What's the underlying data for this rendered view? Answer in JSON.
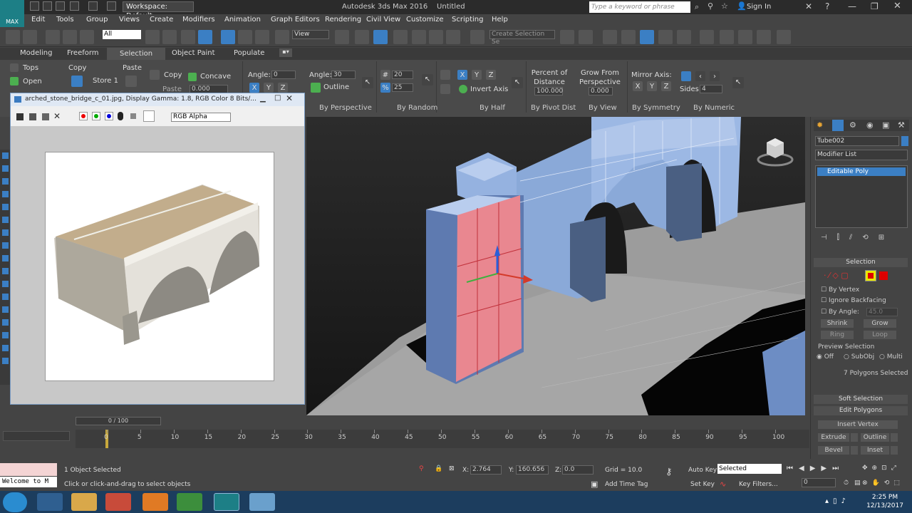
{
  "titlebar": {
    "logo": "MAX",
    "workspace": "Workspace: Default",
    "app_title": "Autodesk 3ds Max 2016",
    "file_name": "Untitled",
    "search_placeholder": "Type a keyword or phrase",
    "sign_in": "Sign In"
  },
  "menu": [
    "Edit",
    "Tools",
    "Group",
    "Views",
    "Create",
    "Modifiers",
    "Animation",
    "Graph Editors",
    "Rendering",
    "Civil View",
    "Customize",
    "Scripting",
    "Help"
  ],
  "toolbar": {
    "selection_filter": "All",
    "reference_coord": "View",
    "create_selection_set": "Create Selection Se"
  },
  "ribbon_tabs": [
    "Modeling",
    "Freeform",
    "Selection",
    "Object Paint",
    "Populate"
  ],
  "ribbon": {
    "tops": "Tops",
    "open": "Open",
    "copy": "Copy",
    "store1": "Store 1",
    "paste": "Paste",
    "copy2": "Copy",
    "paste2": "Paste",
    "concave": "Concave",
    "outline_val": "0.000",
    "angle_label": "Angle:",
    "angle_value": "0",
    "angle2_label": "Angle:",
    "angle2_value": "30",
    "outline": "Outline",
    "random_a": "20",
    "random_b": "25",
    "invert_axis": "Invert Axis",
    "percent_label": "Percent of Distance From",
    "percent_value": "100.000",
    "grow_label": "Grow From Perspective View",
    "grow_value": "0.000",
    "mirror_axis": "Mirror Axis:",
    "sides_label": "Sides:",
    "sides_value": "4",
    "x": "X",
    "y": "Y",
    "z": "Z",
    "groups": [
      "By Perspective",
      "By Random",
      "By Half",
      "By Pivot Dist",
      "By View",
      "By Symmetry",
      "By Numeric"
    ]
  },
  "image_window": {
    "title": "arched_stone_bridge_c_01.jpg, Display Gamma: 1.8, RGB Color 8 Bits/...",
    "channel": "RGB Alpha"
  },
  "command_panel": {
    "object_name": "Tube002",
    "modifier_list": "Modifier List",
    "stack_item": "Editable Poly",
    "selection_header": "Selection",
    "by_vertex": "By Vertex",
    "ignore_backfacing": "Ignore Backfacing",
    "by_angle": "By Angle:",
    "angle_value": "45.0",
    "shrink": "Shrink",
    "grow": "Grow",
    "ring": "Ring",
    "loop": "Loop",
    "preview_selection": "Preview Selection",
    "off": "Off",
    "subobj": "SubObj",
    "multi": "Multi",
    "selected_count": "7 Polygons Selected",
    "soft_selection": "Soft Selection",
    "edit_polygons": "Edit Polygons",
    "insert_vertex": "Insert Vertex",
    "extrude": "Extrude",
    "outline": "Outline",
    "bevel": "Bevel",
    "inset": "Inset"
  },
  "timeline": {
    "slider": "0 / 100",
    "ticks": [
      "0",
      "5",
      "10",
      "15",
      "20",
      "25",
      "30",
      "35",
      "40",
      "45",
      "50",
      "55",
      "60",
      "65",
      "70",
      "75",
      "80",
      "85",
      "90",
      "95",
      "100"
    ]
  },
  "status": {
    "maxscript": "Welcome to M",
    "objects_selected": "1 Object Selected",
    "prompt": "Click or click-and-drag to select objects",
    "x_label": "X:",
    "x_value": "2.764",
    "y_label": "Y:",
    "y_value": "160.656",
    "z_label": "Z:",
    "z_value": "0.0",
    "grid": "Grid = 10.0",
    "auto_key": "Auto Key",
    "set_key": "Set Key",
    "key_mode": "Selected",
    "key_filters": "Key Filters...",
    "add_time_tag": "Add Time Tag",
    "frame": "0"
  },
  "taskbar": {
    "time": "2:25 PM",
    "date": "12/13/2017"
  }
}
